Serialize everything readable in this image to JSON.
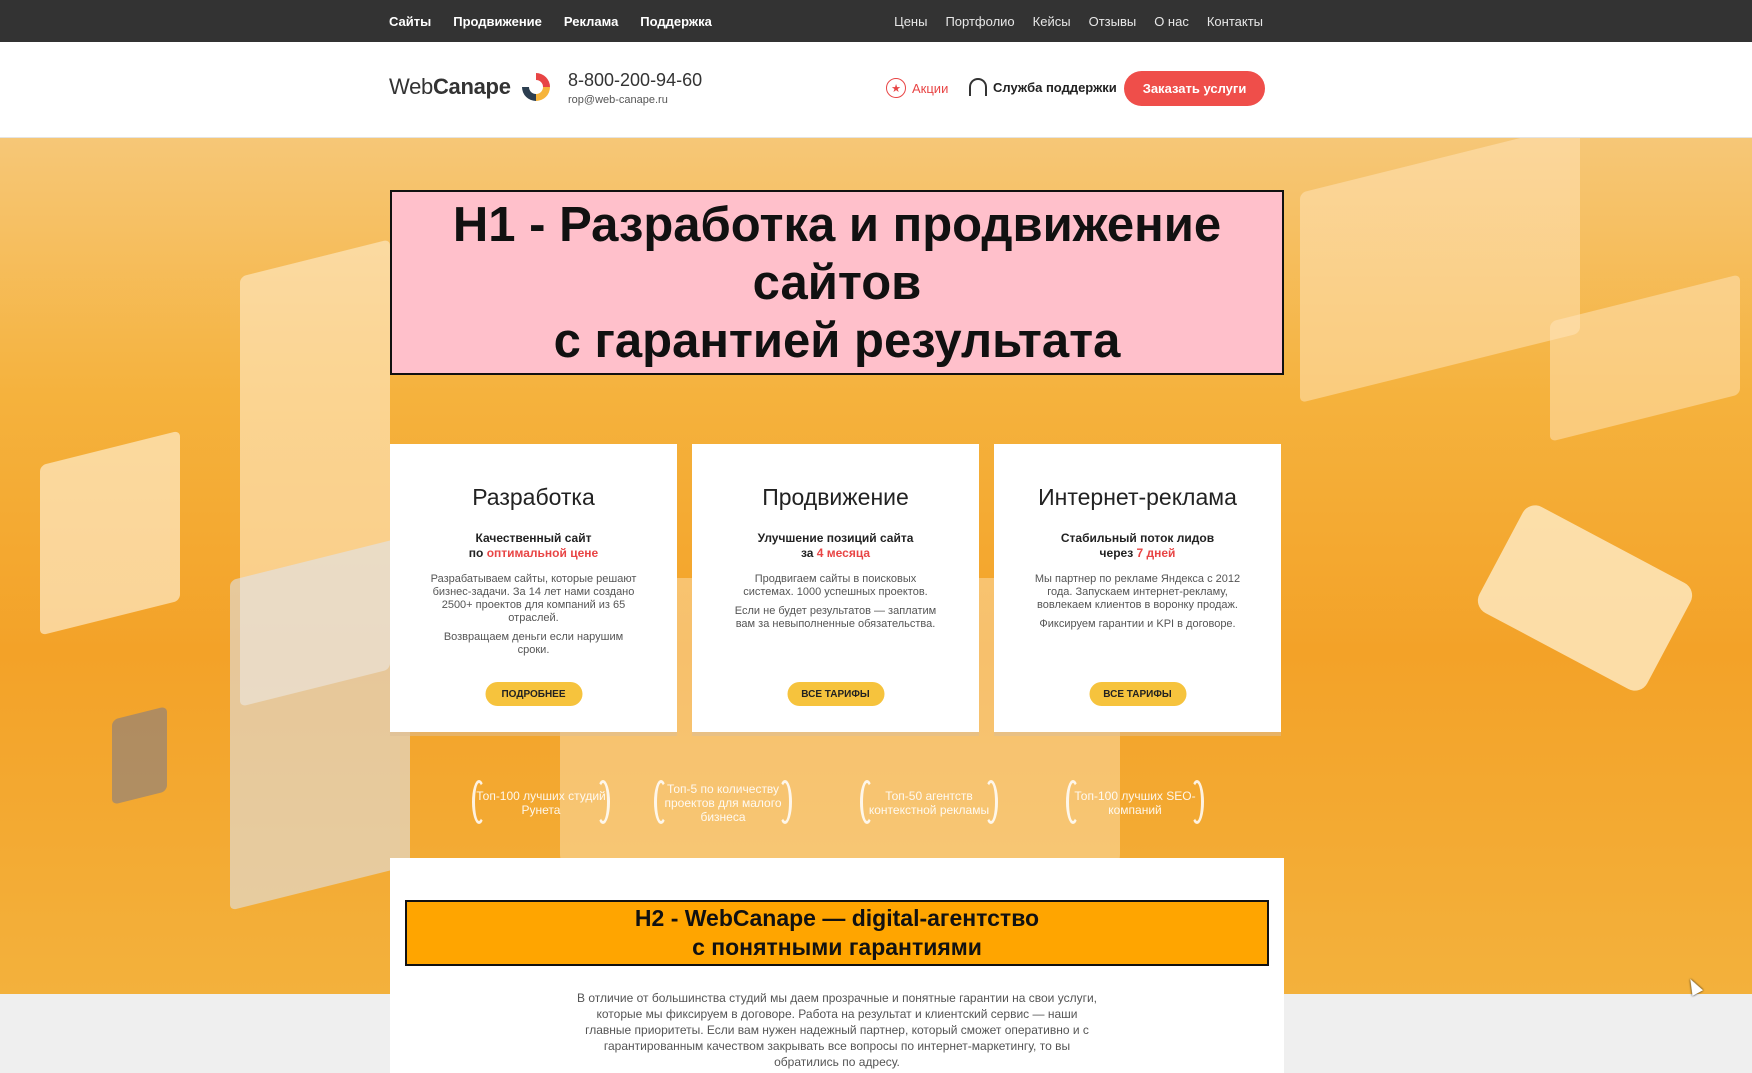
{
  "topbar": {
    "left": [
      "Сайты",
      "Продвижение",
      "Реклама",
      "Поддержка"
    ],
    "right": [
      "Цены",
      "Портфолио",
      "Кейсы",
      "Отзывы",
      "О нас",
      "Контакты"
    ]
  },
  "header": {
    "logo_a": "Web",
    "logo_b": "Canape",
    "phone": "8-800-200-94-60",
    "email": "rop@web-canape.ru",
    "promo": "Акции",
    "support": "Служба поддержки",
    "order_button": "Заказать услуги"
  },
  "hero": {
    "h1_line1": "H1 - Разработка и продвижение",
    "h1_line2": "сайтов",
    "h1_line3": "с гарантией результата"
  },
  "cards": [
    {
      "title": "Разработка",
      "sub1": "Качественный сайт",
      "sub2_prefix": "по ",
      "sub2_hl": "оптимальной цене",
      "desc": "Разрабатываем сайты, которые решают бизнес-задачи. За 14 лет нами создано 2500+ проектов для компаний из 65 отраслей.",
      "desc2": "Возвращаем деньги если нарушим сроки.",
      "button": "ПОДРОБНЕЕ"
    },
    {
      "title": "Продвижение",
      "sub1": "Улучшение позиций сайта",
      "sub2_prefix": "за ",
      "sub2_hl": "4 месяца",
      "desc": "Продвигаем сайты в поисковых системах. 1000 успешных проектов.",
      "desc2": "Если не будет результатов — заплатим вам за невыполненные обязательства.",
      "button": "ВСЕ ТАРИФЫ"
    },
    {
      "title": "Интернет-реклама",
      "sub1": "Стабильный поток лидов",
      "sub2_prefix": "через ",
      "sub2_hl": "7 дней",
      "desc": "Мы партнер по рекламе Яндекса с 2012 года. Запускаем интернет-рекламу, вовлекаем клиентов в воронку продаж.",
      "desc2": "Фиксируем гарантии и KPI в договоре.",
      "button": "ВСЕ ТАРИФЫ"
    }
  ],
  "awards": [
    "Топ-100 лучших студий Рунета",
    "Топ-5 по количеству проектов для малого бизнеса",
    "Топ-50 агентств контекстной рекламы",
    "Топ-100 лучших SEO-компаний"
  ],
  "content": {
    "h2_line1": "H2 - WebCanape — digital-агентство",
    "h2_line2": "с понятными гарантиями",
    "paragraph": "В отличие от большинства студий мы даем прозрачные и понятные гарантии на свои услуги, которые мы фиксируем в договоре. Работа на результат и клиентский сервис — наши главные приоритеты. Если вам нужен надежный партнер, который сможет оперативно и с гарантированным качеством закрывать все вопросы по интернет-маркетингу, то вы обратились по адресу."
  },
  "colors": {
    "topbar": "#333333",
    "accent_red": "#ef4e4a",
    "yellow_button": "#f6c33d",
    "h1_bg": "#ffc0cb",
    "h2_bg": "#ffa500"
  }
}
